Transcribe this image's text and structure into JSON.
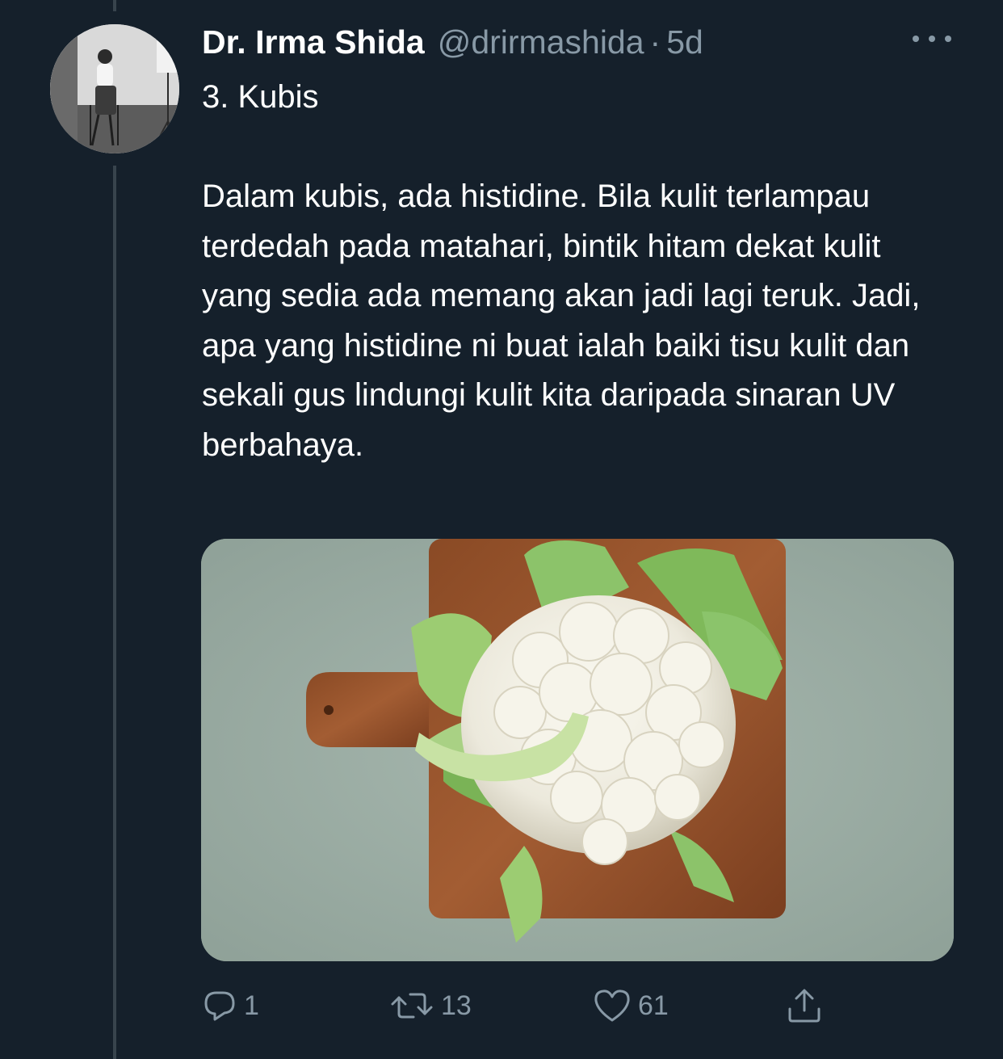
{
  "tweet": {
    "display_name": "Dr. Irma Shida",
    "handle": "@drirmashida",
    "separator": "·",
    "time": "5d",
    "text": "3. Kubis\n\nDalam kubis, ada histidine. Bila kulit terlampau terdedah pada matahari, bintik hitam dekat kulit yang sedia ada memang akan jadi lagi teruk. Jadi, apa yang histidine ni buat ialah baiki tisu kulit dan sekali gus lindungi kulit kita daripada sinaran UV berbahaya."
  },
  "actions": {
    "reply_count": "1",
    "retweet_count": "13",
    "like_count": "61"
  },
  "icons": {
    "reply": "reply-icon",
    "retweet": "retweet-icon",
    "like": "heart-icon",
    "share": "share-icon",
    "more": "more-icon"
  },
  "colors": {
    "background": "#15202b",
    "secondary_text": "#8899a6",
    "thread_line": "#38444d"
  }
}
